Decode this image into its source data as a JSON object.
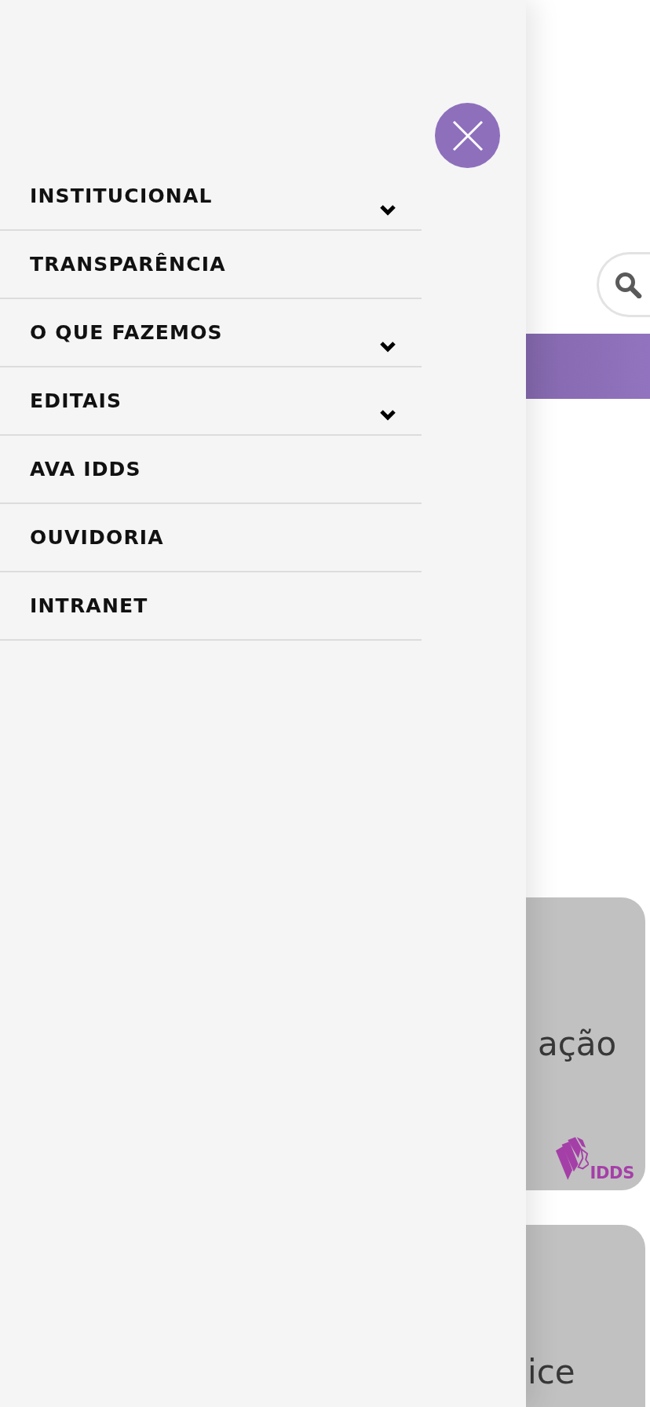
{
  "drawer": {
    "menu": [
      {
        "label": "INSTITUCIONAL",
        "has_submenu": true
      },
      {
        "label": "TRANSPARÊNCIA",
        "has_submenu": false
      },
      {
        "label": "O QUE FAZEMOS",
        "has_submenu": true
      },
      {
        "label": "EDITAIS",
        "has_submenu": true
      },
      {
        "label": "AVA IDDS",
        "has_submenu": false
      },
      {
        "label": "OUVIDORIA",
        "has_submenu": false
      },
      {
        "label": "INTRANET",
        "has_submenu": false
      }
    ]
  },
  "page": {
    "banners": [
      {
        "text": "ação",
        "logo_text": "IDDS"
      },
      {
        "text": "ice"
      }
    ]
  }
}
